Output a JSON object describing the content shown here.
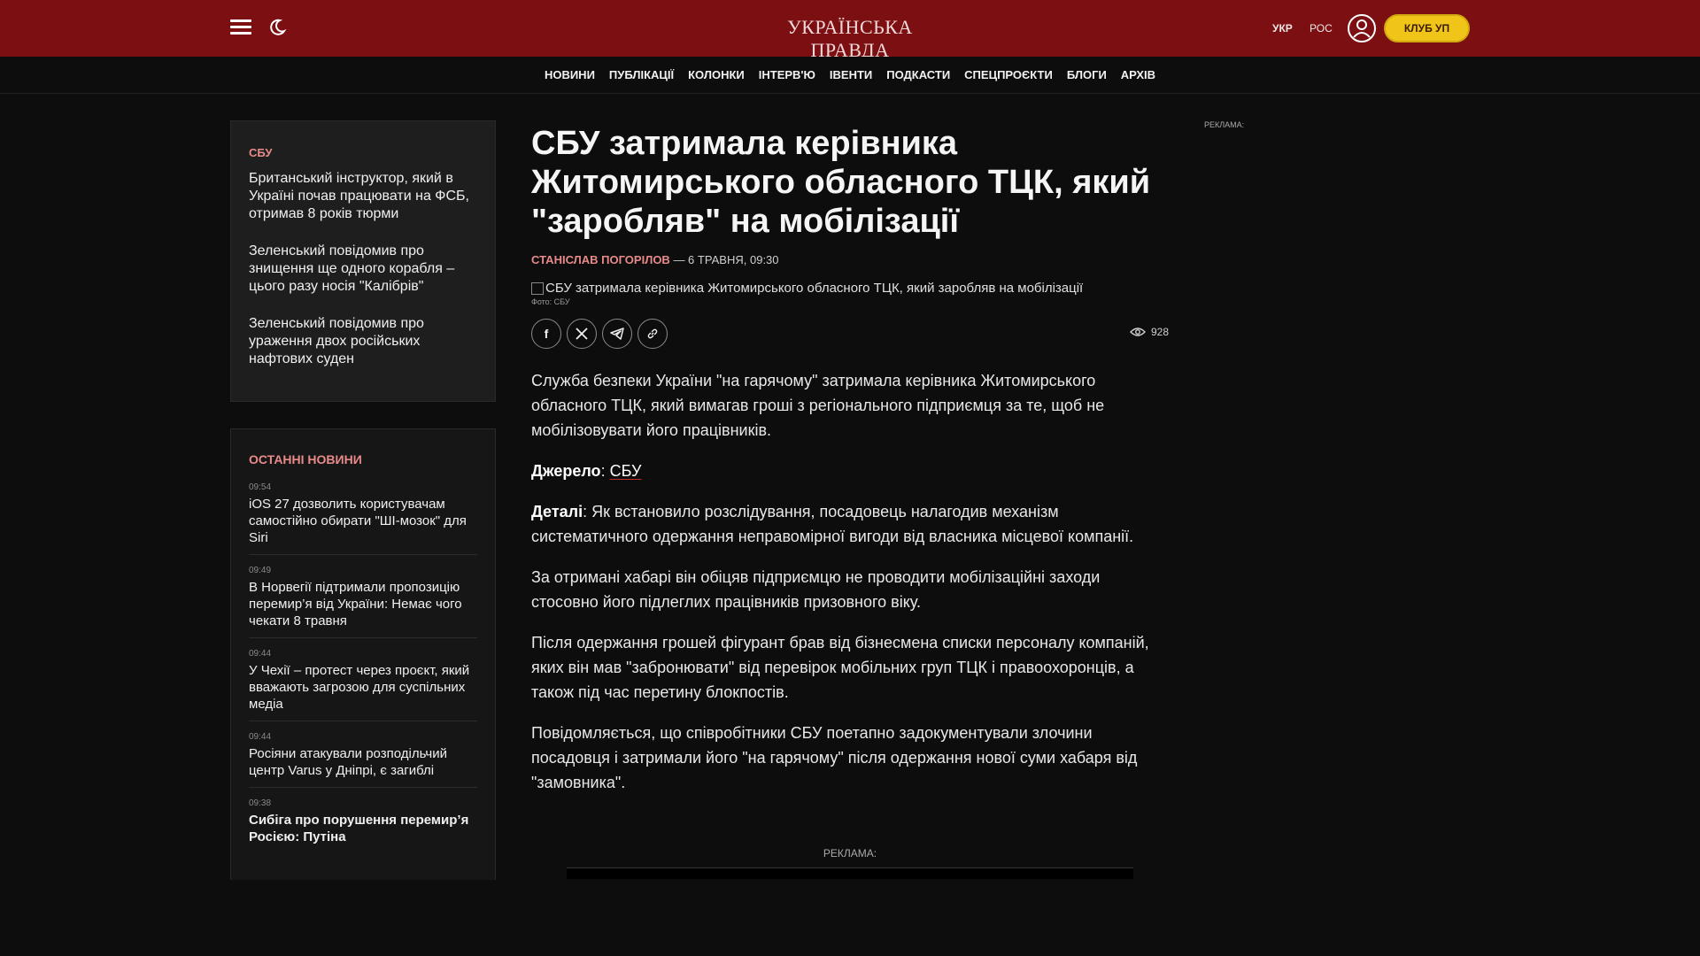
{
  "header": {
    "logo": "УКРАЇНСЬКА ПРАВДА",
    "lang_ukr": "УКР",
    "lang_ros": "РОС",
    "club_label": "КЛУБ УП"
  },
  "nav": [
    "НОВИНИ",
    "ПУБЛІКАЦІЇ",
    "КОЛОНКИ",
    "ІНТЕРВ'Ю",
    "ІВЕНТИ",
    "ПОДКАСТИ",
    "СПЕЦПРОЄКТИ",
    "БЛОГИ",
    "АРХІВ"
  ],
  "related": {
    "tag": "СБУ",
    "items": [
      "Британський інструктор, який в Україні почав працювати на ФСБ, отримав 8 років тюрми",
      "Зеленський повідомив про знищення ще одного корабля – цього разу носія \"Калібрів\"",
      "Зеленський повідомив про ураження двох російських нафтових суден"
    ]
  },
  "latest": {
    "header": "ОСТАННІ НОВИНИ",
    "items": [
      {
        "time": "09:54",
        "headline": "iOS 27 дозволить користувачам самостійно обирати \"ШІ-мозок\" для Siri",
        "bold": false
      },
      {
        "time": "09:49",
        "headline": "В Норвегії підтримали пропозицію перемир’я від України: Немає чого чекати 8 травня",
        "bold": false
      },
      {
        "time": "09:44",
        "headline": "У Чехії – протест через проєкт, який вважають загрозою для суспільних медіа",
        "bold": false
      },
      {
        "time": "09:44",
        "headline": "Росіяни атакували розподільчий центр Varus у Дніпрі, є загиблі",
        "bold": false
      },
      {
        "time": "09:38",
        "headline": "Сибіга про порушення перемир’я Росією: Путіна",
        "bold": true
      }
    ]
  },
  "article": {
    "title": "СБУ затримала керівника Житомирського обласного ТЦК, який \"заробляв\" на мобілізації",
    "author": "СТАНІСЛАВ ПОГОРІЛОВ",
    "date": " — 6 ТРАВНЯ, 09:30",
    "photo_alt": "СБУ затримала керівника Житомирського обласного ТЦК, який заробляв на мобілізації",
    "photo_caption": "Фото: СБУ",
    "views": "928",
    "p1": "Служба безпеки України \"на гарячому\" затримала керівника Житомирського обласного ТЦК, який вимагав гроші з регіонального підприємця за те, щоб не мобілізовувати його працівників.",
    "source_label": "Джерело",
    "source_sep": ": ",
    "source_link": "СБУ",
    "details_label": "Деталі",
    "details_text": ": Як встановило розслідування, посадовець налагодив механізм систематичного одержання неправомірної вигоди від власника місцевої компанії.",
    "p3": "За отримані хабарі він обіцяв підприємцю не проводити мобілізаційні заходи стосовно його підлеглих працівників призовного віку.",
    "p4": "Після одержання грошей фігурант брав від бізнесмена списки персоналу компаній, яких він мав \"забронювати\" від перевірок мобільних груп ТЦК і правоохоронців, а також під час перетину блокпостів.",
    "p5": "Повідомляється, що співробітники СБУ поетапно задокументували злочини посадовця і затримали його \"на гарячому\" після одержання нової суми хабаря від \"замовника\"."
  },
  "ads": {
    "right_label": "РЕКЛАМА:",
    "mid_label": "РЕКЛАМА:"
  },
  "icons": {
    "menu": "menu-icon",
    "theme": "moon-icon",
    "user": "user-icon",
    "facebook": "facebook-icon",
    "x": "x-icon",
    "telegram": "telegram-icon",
    "link": "link-icon",
    "views": "eye-icon"
  },
  "colors": {
    "header_bg": "#7b0f12",
    "accent": "#e88a8a",
    "club_button": "#f0c419"
  }
}
